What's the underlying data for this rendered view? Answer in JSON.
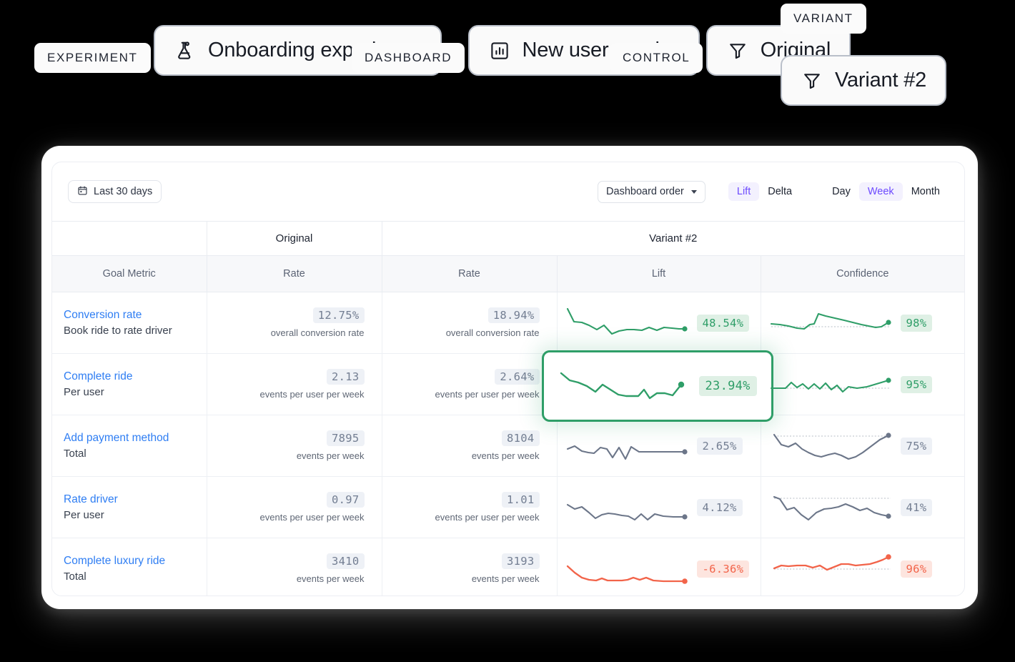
{
  "callouts": [
    {
      "tag": "EXPERIMENT",
      "label": "Onboarding experiment",
      "icon": "flask-icon"
    },
    {
      "tag": "DASHBOARD",
      "label": "New user metrics",
      "icon": "bar-chart-icon"
    },
    {
      "tag": "CONTROL",
      "label": "Original",
      "icon": "funnel-icon"
    },
    {
      "tag": "VARIANT",
      "label": "Variant #2",
      "icon": "funnel-icon"
    }
  ],
  "toolbar": {
    "date_range_label": "Last 30 days",
    "date_range_icon": "calendar-icon",
    "sort_select_label": "Dashboard order",
    "metric_toggle": [
      {
        "label": "Lift",
        "active": true
      },
      {
        "label": "Delta",
        "active": false
      }
    ],
    "granularity_toggle": [
      {
        "label": "Day",
        "active": false
      },
      {
        "label": "Week",
        "active": true
      },
      {
        "label": "Month",
        "active": false
      }
    ]
  },
  "table": {
    "groups": {
      "blank": "",
      "original": "Original",
      "variant": "Variant #2"
    },
    "columns": [
      "Goal Metric",
      "Rate",
      "Rate",
      "Lift",
      "Confidence"
    ],
    "rows": [
      {
        "goal_name": "Conversion rate",
        "goal_sub": "Book ride to rate driver",
        "original_rate": "12.75%",
        "original_unit": "overall conversion rate",
        "variant_rate": "18.94%",
        "variant_unit": "overall conversion rate",
        "lift": "48.54%",
        "lift_tone": "green",
        "confidence": "98%",
        "confidence_tone": "green",
        "highlighted": false
      },
      {
        "goal_name": "Complete ride",
        "goal_sub": "Per user",
        "original_rate": "2.13",
        "original_unit": "events per user per week",
        "variant_rate": "2.64%",
        "variant_unit": "events per user per week",
        "lift": "23.94%",
        "lift_tone": "green",
        "confidence": "95%",
        "confidence_tone": "green",
        "highlighted": true
      },
      {
        "goal_name": "Add payment method",
        "goal_sub": "Total",
        "original_rate": "7895",
        "original_unit": "events per week",
        "variant_rate": "8104",
        "variant_unit": "events per week",
        "lift": "2.65%",
        "lift_tone": "grey",
        "confidence": "75%",
        "confidence_tone": "grey",
        "highlighted": false
      },
      {
        "goal_name": "Rate driver",
        "goal_sub": "Per user",
        "original_rate": "0.97",
        "original_unit": "events per user per week",
        "variant_rate": "1.01",
        "variant_unit": "events per user per week",
        "lift": "4.12%",
        "lift_tone": "grey",
        "confidence": "41%",
        "confidence_tone": "grey",
        "highlighted": false
      },
      {
        "goal_name": "Complete luxury ride",
        "goal_sub": "Total",
        "original_rate": "3410",
        "original_unit": "events per week",
        "variant_rate": "3193",
        "variant_unit": "events per week",
        "lift": "-6.36%",
        "lift_tone": "red",
        "confidence": "96%",
        "confidence_tone": "red",
        "highlighted": false
      }
    ]
  },
  "colors": {
    "green": "#2f9e68",
    "grey": "#6c7689",
    "red": "#f2644a",
    "link_blue": "#2f7ef3",
    "accent_purple": "#6d4aff"
  },
  "chart_data": [
    {
      "type": "line",
      "name": "lift-sparkline-conversion-rate",
      "series_color": "#2f9e68",
      "y": [
        92,
        64,
        58,
        56,
        46,
        56,
        34,
        42,
        46,
        46,
        44,
        52,
        44,
        52,
        50,
        48,
        48
      ]
    },
    {
      "type": "line",
      "name": "confidence-sparkline-conversion-rate",
      "series_color": "#2f9e68",
      "reference_line": 20,
      "y": [
        32,
        30,
        26,
        20,
        18,
        30,
        32,
        56,
        50,
        46,
        42,
        36,
        30,
        26,
        22,
        24,
        36
      ]
    },
    {
      "type": "line",
      "name": "lift-sparkline-complete-ride",
      "series_color": "#2f9e68",
      "y": [
        86,
        70,
        66,
        60,
        48,
        66,
        52,
        42,
        38,
        38,
        38,
        52,
        30,
        44,
        44,
        38,
        62
      ]
    },
    {
      "type": "line",
      "name": "confidence-sparkline-complete-ride",
      "series_color": "#2f9e68",
      "reference_line": 24,
      "y": [
        26,
        26,
        26,
        44,
        28,
        38,
        24,
        38,
        24,
        40,
        22,
        34,
        16,
        30,
        26,
        30,
        52
      ]
    },
    {
      "type": "line",
      "name": "lift-sparkline-add-payment-method",
      "series_color": "#6c7689",
      "y": [
        52,
        58,
        46,
        42,
        40,
        54,
        50,
        28,
        54,
        24,
        56,
        42,
        42,
        42,
        42,
        42,
        42
      ]
    },
    {
      "type": "line",
      "name": "confidence-sparkline-add-payment-method",
      "series_color": "#6c7689",
      "reference_line": 66,
      "y": [
        70,
        52,
        48,
        54,
        44,
        38,
        34,
        32,
        36,
        38,
        34,
        28,
        32,
        40,
        52,
        62,
        70
      ]
    },
    {
      "type": "line",
      "name": "lift-sparkline-rate-driver",
      "series_color": "#6c7689",
      "y": [
        60,
        52,
        56,
        46,
        36,
        44,
        46,
        44,
        42,
        40,
        34,
        44,
        34,
        44,
        40,
        38,
        38
      ]
    },
    {
      "type": "line",
      "name": "confidence-sparkline-rate-driver",
      "series_color": "#6c7689",
      "reference_line": 64,
      "y": [
        70,
        66,
        44,
        48,
        34,
        26,
        40,
        46,
        48,
        50,
        56,
        50,
        44,
        48,
        40,
        36,
        34
      ]
    },
    {
      "type": "line",
      "name": "lift-sparkline-complete-luxury-ride",
      "series_color": "#f2644a",
      "y": [
        54,
        40,
        28,
        22,
        20,
        26,
        20,
        20,
        20,
        22,
        26,
        22,
        26,
        20,
        18,
        18,
        18
      ]
    },
    {
      "type": "line",
      "name": "confidence-sparkline-complete-luxury-ride",
      "series_color": "#f2644a",
      "reference_line": 28,
      "y": [
        34,
        40,
        38,
        40,
        40,
        36,
        40,
        30,
        36,
        42,
        42,
        40,
        42,
        44,
        48,
        54,
        62
      ]
    }
  ]
}
